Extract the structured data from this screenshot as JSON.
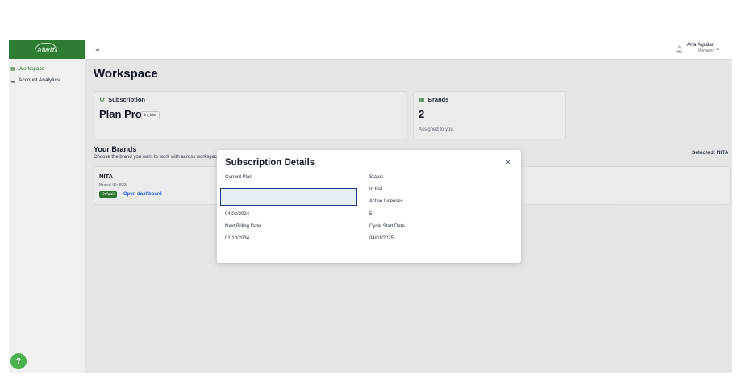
{
  "header": {
    "logo_text": "aiwifi",
    "user_name": "Ana Aguilar",
    "user_role": "Manager"
  },
  "sidebar": {
    "items": [
      {
        "label": "Workspace",
        "active": true
      },
      {
        "label": "Account Analytics",
        "active": false
      }
    ]
  },
  "main": {
    "title": "Workspace",
    "subscription_card": {
      "heading": "Subscription",
      "plan": "Plan Pro",
      "status_badge": "in_trial"
    },
    "brands_card": {
      "heading": "Brands",
      "count": "2",
      "note": "Assigned to you."
    },
    "your_brands": {
      "title": "Your Brands",
      "subtitle": "Choose the brand you want to work with across workspace.",
      "selected": "Selected: NITA",
      "brands": [
        {
          "name": "NITA",
          "id_text": "Brand ID: 823",
          "badge": "Default",
          "link": "Open dashboard"
        }
      ]
    }
  },
  "modal": {
    "title": "Subscription Details",
    "fields": {
      "current_plan_label": "Current Plan",
      "current_plan_value": "",
      "status_label": "Status",
      "status_value": "In trial",
      "active_licenses_label": "Active Licenses",
      "active_licenses_value": "5",
      "date_value": "04/02/2024",
      "next_billing_label": "Next Billing Date",
      "next_billing_value": "01/13/2034",
      "cycle_start_label": "Cycle Start Date",
      "cycle_start_value": "04/01/2025"
    }
  },
  "colors": {
    "brand_green": "#2e7d32",
    "help_green": "#4caf50",
    "link_blue": "#2563eb"
  },
  "icons": {
    "menu": "hamburger-icon",
    "bell": "bell-icon",
    "close": "close-icon",
    "help": "help-icon"
  }
}
